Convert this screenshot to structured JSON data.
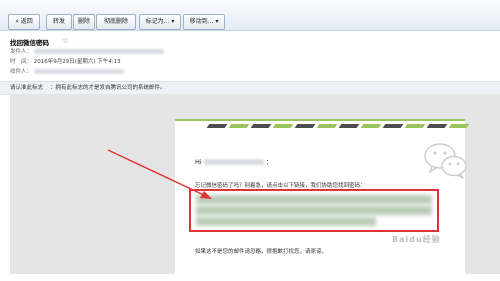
{
  "toolbar": {
    "back": "« 返回",
    "forward": "转发",
    "delete": "删除",
    "delete_permanent": "彻底删除",
    "mark_as": "标记为...",
    "move_to": "移动到...",
    "dropdown_arrow": "▾"
  },
  "email": {
    "subject": "找回微信密码",
    "from_label": "发件人：",
    "time_label": "时　间：",
    "time_value": "2016年9月29日(星期六) 下午4:13",
    "to_label": "收件人："
  },
  "notice": {
    "label": "请认准此标志",
    "text": "：拥有此标志的才是发自腾讯公司的系统邮件。"
  },
  "letter": {
    "greeting_prefix": "Hi",
    "greeting_suffix": "：",
    "body": "忘记微信密码了吗？别着急，请点击以下链接，我们协助您找回密码：",
    "footer": "如果这不是您的邮件请忽略，很抱歉打扰您，请原谅。"
  },
  "watermark": "Baidu经验",
  "colors": {
    "highlight": "#e03434",
    "stripe_green": "#9bc45f",
    "stripe_dark": "#4d4d4d"
  }
}
